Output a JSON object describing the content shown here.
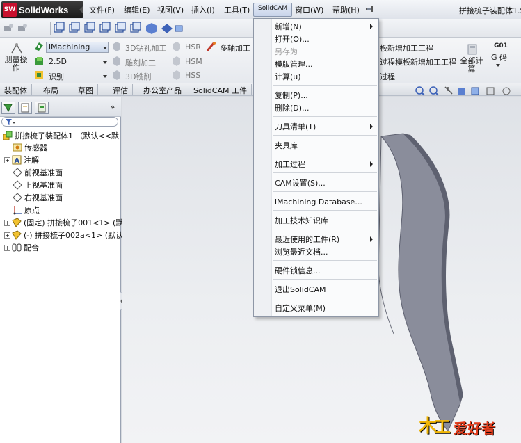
{
  "app": {
    "logo_badge": "SW",
    "logo_text": "SolidWorks",
    "title": "拼接梳子装配体1.S"
  },
  "menubar": {
    "items": [
      "文件(F)",
      "编辑(E)",
      "视图(V)",
      "插入(I)",
      "工具(T)",
      "SolidCAM",
      "窗口(W)",
      "帮助(H)"
    ]
  },
  "cmd": {
    "measure": "测量操作",
    "imachining": "iMachining",
    "d25": "2.5D",
    "identify": "识别",
    "drill3d": "3D钻孔加工",
    "engrave": "雕刻加工",
    "mill3d": "3D铣削",
    "hsr": "HSR",
    "hsm": "HSM",
    "hss": "HSS",
    "multiaxis": "多轴加工",
    "tpl_new": "板新增加工工程",
    "tpl_new2": "过程模板新增加工工程",
    "process": "过程",
    "all_parts": "全部计算",
    "g01": "G01",
    "gcode": "G 码"
  },
  "tabs": [
    "装配体",
    "布局",
    "草图",
    "评估",
    "办公室产品",
    "SolidCAM 工件"
  ],
  "tree": {
    "root": "拼接梳子装配体1 （默认<<默",
    "items": [
      {
        "label": "传感器",
        "expand": false
      },
      {
        "label": "注解",
        "expand": true
      },
      {
        "label": "前视基准面",
        "expand": false
      },
      {
        "label": "上视基准面",
        "expand": false
      },
      {
        "label": "右视基准面",
        "expand": false
      },
      {
        "label": "原点",
        "expand": false
      },
      {
        "label": "(固定) 拼接梳子001<1> (默",
        "expand": true
      },
      {
        "label": "(-) 拼接梳子002a<1> (默认",
        "expand": true
      },
      {
        "label": "配合",
        "expand": true
      }
    ]
  },
  "dropdown": {
    "items": [
      {
        "label": "新增(N)",
        "submenu": true,
        "disabled": false
      },
      {
        "label": "打开(O)...",
        "submenu": false,
        "disabled": false
      },
      {
        "label": "另存为",
        "submenu": false,
        "disabled": true
      },
      {
        "label": "模版管理...",
        "submenu": false,
        "disabled": false
      },
      {
        "label": "计算(u)",
        "submenu": false,
        "disabled": false
      },
      {
        "label": "复制(P)...",
        "submenu": false,
        "disabled": false
      },
      {
        "label": "删除(D)...",
        "submenu": false,
        "disabled": false
      },
      {
        "label": "刀具清单(T)",
        "submenu": true,
        "disabled": false
      },
      {
        "label": "夹具库",
        "submenu": false,
        "disabled": false
      },
      {
        "label": "加工过程",
        "submenu": true,
        "disabled": false
      },
      {
        "label": "CAM设置(S)...",
        "submenu": false,
        "disabled": false
      },
      {
        "label": "iMachining Database...",
        "submenu": false,
        "disabled": false
      },
      {
        "label": "加工技术知识库",
        "submenu": false,
        "disabled": false
      },
      {
        "label": "最近使用的工件(R)",
        "submenu": true,
        "disabled": false
      },
      {
        "label": "浏览最近文档...",
        "submenu": false,
        "disabled": false
      },
      {
        "label": "硬件锁信息...",
        "submenu": false,
        "disabled": false
      },
      {
        "label": "退出SolidCAM",
        "submenu": false,
        "disabled": false
      },
      {
        "label": "自定义菜单(M)",
        "submenu": false,
        "disabled": false
      }
    ]
  },
  "watermark": {
    "text1": "木",
    "text2": "工",
    "text3": "爱好者"
  },
  "colors": {
    "part_face": "#7f8290",
    "part_edge": "#5e6170",
    "menu_highlight": "#c8d4ea",
    "logo_red": "#c8102e"
  }
}
